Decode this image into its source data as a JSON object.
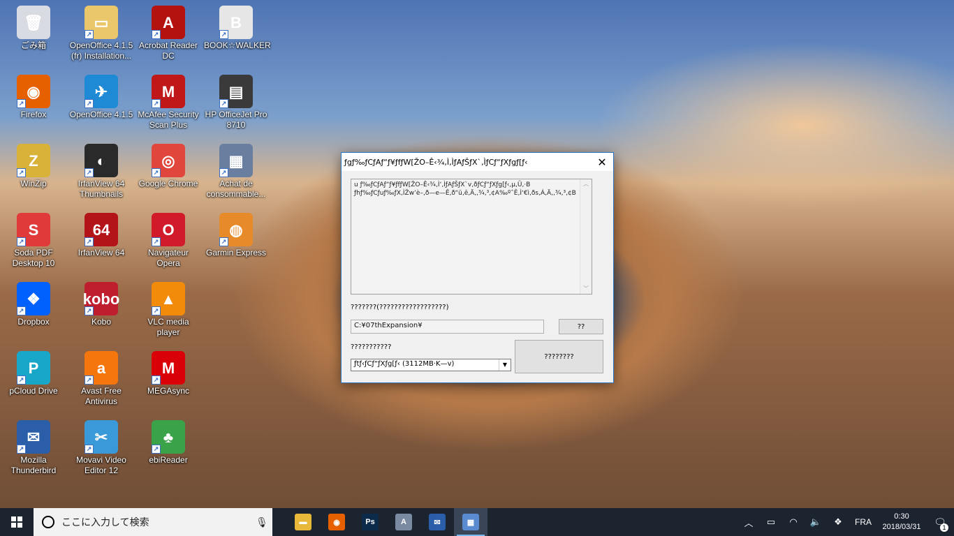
{
  "desktop": {
    "icons": [
      {
        "label": "ごみ箱",
        "glyph": "🗑",
        "bg": "#d8dce2"
      },
      {
        "label": "OpenOffice 4.1.5 (fr) Installation...",
        "glyph": "▭",
        "bg": "#e9c76a"
      },
      {
        "label": "Acrobat Reader DC",
        "glyph": "A",
        "bg": "#b3120f"
      },
      {
        "label": "BOOK☆WALKER",
        "glyph": "B",
        "bg": "#e6e6e6"
      },
      {
        "label": "Firefox",
        "glyph": "◉",
        "bg": "#e66000"
      },
      {
        "label": "OpenOffice 4.1.5",
        "glyph": "✈",
        "bg": "#1e8ad6"
      },
      {
        "label": "McAfee Security Scan Plus",
        "glyph": "M",
        "bg": "#c01818"
      },
      {
        "label": "HP OfficeJet Pro 8710",
        "glyph": "▤",
        "bg": "#3a3a3a"
      },
      {
        "label": "WinZip",
        "glyph": "Z",
        "bg": "#d9b23a"
      },
      {
        "label": "IrfanView 64 Thumbnails",
        "glyph": "◐",
        "bg": "#2a2a2a"
      },
      {
        "label": "Google Chrome",
        "glyph": "◎",
        "bg": "#e0463b"
      },
      {
        "label": "Achat de consommable...",
        "glyph": "▦",
        "bg": "#6a7fa0"
      },
      {
        "label": "Soda PDF Desktop 10",
        "glyph": "S",
        "bg": "#e03a3a"
      },
      {
        "label": "IrfanView 64",
        "glyph": "64",
        "bg": "#b3141a"
      },
      {
        "label": "Navigateur Opera",
        "glyph": "O",
        "bg": "#d11a2a"
      },
      {
        "label": "Garmin Express",
        "glyph": "◍",
        "bg": "#e78a2a"
      },
      {
        "label": "Dropbox",
        "glyph": "❖",
        "bg": "#0061fe"
      },
      {
        "label": "Kobo",
        "glyph": "kobo",
        "bg": "#bf1e2e"
      },
      {
        "label": "VLC media player",
        "glyph": "▲",
        "bg": "#f28a0a"
      },
      {
        "label": "pCloud Drive",
        "glyph": "P",
        "bg": "#18a7c9"
      },
      {
        "label": "Avast Free Antivirus",
        "glyph": "a",
        "bg": "#f4760c"
      },
      {
        "label": "MEGAsync",
        "glyph": "M",
        "bg": "#d90007"
      },
      {
        "label": "Mozilla Thunderbird",
        "glyph": "✉",
        "bg": "#2a5ea8"
      },
      {
        "label": "Movavi Video Editor 12",
        "glyph": "✂",
        "bg": "#3a9ad9"
      },
      {
        "label": "ebiReader",
        "glyph": "♣",
        "bg": "#3aa34a"
      }
    ]
  },
  "dialog": {
    "title": "ƒgƒ‰ƒCƒAƒ“ƒ¥ƒfƒW[ŽO–Ê‹¾‚Ì‚ÌƒAƒŠƒX`‚ÌƒCƒ“ƒXƒgƒ[ƒ‹",
    "close": "✕",
    "message": "u ƒ‰ƒCƒAƒ“ƒ¥ƒfƒW[ŽO–Ê‹¾‚Ì‘‚ÌƒAƒŠƒX`v‚ðƒCƒ“ƒXƒg[ƒ‹‚µ‚Ü‚·B ƒhƒ‰ƒCƒuƒ‰ƒX‚ÌŽw’è–­‚ð—e—Ê‚ð“ü‚ê‚Ä‚­‚¾‚³‚¢A‰ºˆÊ‚Ì‘€ì‚ðs‚Á‚Ä‚­‚¾‚³‚¢B",
    "path_label": "???????(??????????????????)",
    "path_value": "C:¥07thExpansion¥",
    "browse_button": "??",
    "size_label": "???????????",
    "combo_value": "ƒtƒ‹ƒCƒ“ƒXƒg[ƒ‹ (3112MB·K—v)",
    "install_button": "????????"
  },
  "taskbar": {
    "search_placeholder": "ここに入力して検索",
    "apps": [
      {
        "name": "file-explorer",
        "glyph": "▬",
        "bg": "#e8b83a"
      },
      {
        "name": "firefox",
        "glyph": "◉",
        "bg": "#e66000"
      },
      {
        "name": "photoshop",
        "glyph": "Ps",
        "bg": "#0c2a4a"
      },
      {
        "name": "acrobat",
        "glyph": "A",
        "bg": "#7a8aa0"
      },
      {
        "name": "thunderbird",
        "glyph": "✉",
        "bg": "#2a5ea8"
      },
      {
        "name": "installer",
        "glyph": "▦",
        "bg": "#5a8ad0"
      }
    ],
    "language": "FRA",
    "time": "0:30",
    "date": "2018/03/31",
    "notification_count": "1"
  }
}
